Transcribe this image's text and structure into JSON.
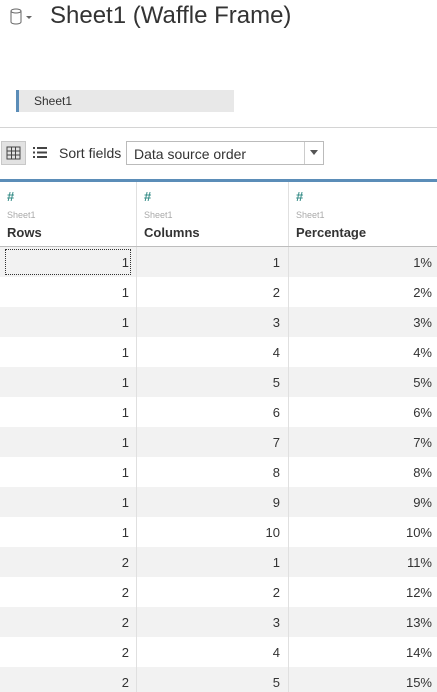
{
  "header": {
    "title": "Sheet1 (Waffle Frame)",
    "icon": "database-icon"
  },
  "sheet_tab": {
    "label": "Sheet1"
  },
  "toolbar": {
    "grid_view_icon": "grid-icon",
    "list_view_icon": "list-icon",
    "sort_label": "Sort fields",
    "sort_value": "Data source order"
  },
  "table": {
    "columns": [
      {
        "type_icon": "#",
        "source": "Sheet1",
        "name": "Rows"
      },
      {
        "type_icon": "#",
        "source": "Sheet1",
        "name": "Columns"
      },
      {
        "type_icon": "#",
        "source": "Sheet1",
        "name": "Percentage"
      }
    ],
    "rows": [
      [
        "1",
        "1",
        "1%"
      ],
      [
        "1",
        "2",
        "2%"
      ],
      [
        "1",
        "3",
        "3%"
      ],
      [
        "1",
        "4",
        "4%"
      ],
      [
        "1",
        "5",
        "5%"
      ],
      [
        "1",
        "6",
        "6%"
      ],
      [
        "1",
        "7",
        "7%"
      ],
      [
        "1",
        "8",
        "8%"
      ],
      [
        "1",
        "9",
        "9%"
      ],
      [
        "1",
        "10",
        "10%"
      ],
      [
        "2",
        "1",
        "11%"
      ],
      [
        "2",
        "2",
        "12%"
      ],
      [
        "2",
        "3",
        "13%"
      ],
      [
        "2",
        "4",
        "14%"
      ],
      [
        "2",
        "5",
        "15%"
      ]
    ]
  },
  "colors": {
    "accent": "#5b8db8",
    "numeric_type": "#3a8f8a",
    "row_alt": "#f2f2f2"
  }
}
